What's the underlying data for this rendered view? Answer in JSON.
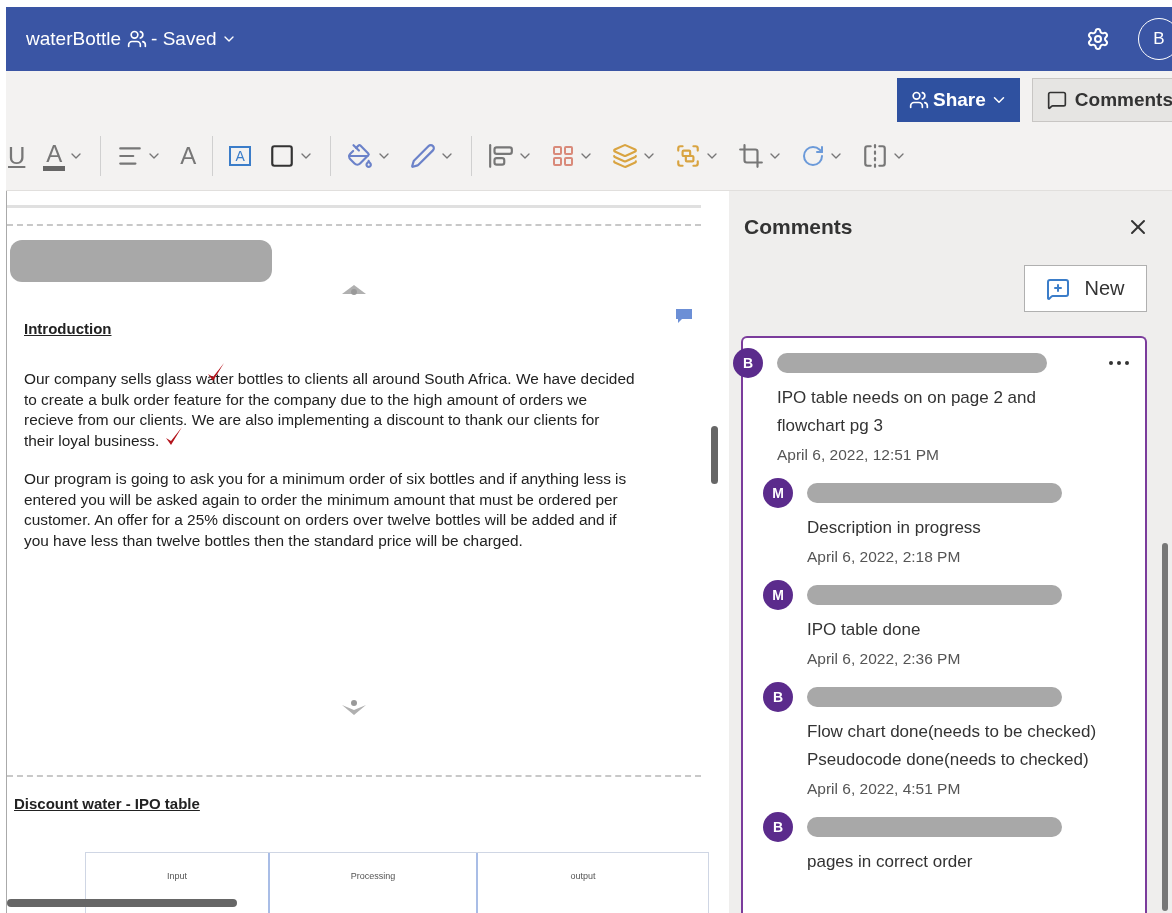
{
  "title_bar": {
    "document": "waterBottle",
    "status": "- Saved",
    "avatar": "B"
  },
  "ribbon": {
    "share": "Share",
    "comments": "Comments",
    "tools": [
      {
        "kind": "underline",
        "label": "U",
        "dropdown": false
      },
      {
        "kind": "font-color",
        "label": "A",
        "dropdown": true
      },
      {
        "kind": "divider"
      },
      {
        "kind": "align",
        "dropdown": true
      },
      {
        "kind": "grow-font",
        "label": "A",
        "dropdown": false
      },
      {
        "kind": "divider"
      },
      {
        "kind": "text-box",
        "label": "A",
        "dropdown": false
      },
      {
        "kind": "shape",
        "dropdown": true
      },
      {
        "kind": "divider"
      },
      {
        "kind": "fill",
        "dropdown": true
      },
      {
        "kind": "outline",
        "dropdown": true
      },
      {
        "kind": "divider"
      },
      {
        "kind": "position",
        "dropdown": true
      },
      {
        "kind": "align-objects",
        "dropdown": true
      },
      {
        "kind": "bring-forward",
        "dropdown": true
      },
      {
        "kind": "group",
        "dropdown": true
      },
      {
        "kind": "crop",
        "dropdown": true
      },
      {
        "kind": "rotate",
        "dropdown": true
      },
      {
        "kind": "flip",
        "dropdown": true
      }
    ]
  },
  "document": {
    "heading": "Introduction",
    "paragraphs": [
      {
        "lines": [
          "Our company sells glass water bottles to clients all around South Africa. We have decided",
          "to create a bulk order feature for the company due to the high amount of orders we",
          "recieve from our clients. We are also implementing a discount to thank our clients for",
          "their loyal business."
        ],
        "marked": true
      },
      {
        "lines": [
          "Our program is going to ask you for a minimum order of six bottles and if anything less is",
          "entered you will be asked again to order the minimum amount that must be ordered per",
          "customer. An offer for a 25% discount on orders over twelve bottles will be added and if",
          "you have less than twelve bottles then the standard price will be charged."
        ],
        "marked": false
      }
    ],
    "section_heading": "Discount water - IPO table",
    "table_headers": [
      "Input",
      "Processing",
      "output"
    ]
  },
  "comments_pane": {
    "title": "Comments",
    "new_button": "New",
    "thread": {
      "avatar": "B",
      "text": "IPO table needs on on page 2 and\nflowchart pg 3",
      "date": "April 6, 2022, 12:51 PM",
      "replies": [
        {
          "avatar": "M",
          "text": "Description in progress",
          "date": "April 6, 2022, 2:18 PM"
        },
        {
          "avatar": "M",
          "text": "IPO table done",
          "date": "April 6, 2022, 2:36 PM"
        },
        {
          "avatar": "B",
          "text": "Flow chart done(needs to be checked)\nPseudocode done(needs to checked)",
          "date": "April 6, 2022, 4:51 PM"
        },
        {
          "avatar": "B",
          "text": "pages in correct order"
        }
      ]
    }
  }
}
